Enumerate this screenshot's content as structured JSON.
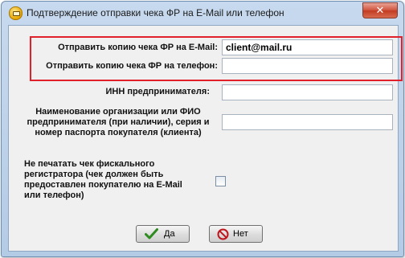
{
  "window": {
    "title": "Подтверждение отправки чека ФР на E-Mail или телефон",
    "close_glyph": "✕"
  },
  "form": {
    "email_label": "Отправить копию чека ФР на  E-Mail:",
    "email_value": "client@mail.ru",
    "phone_label": "Отправить копию чека ФР на телефон:",
    "phone_value": "",
    "inn_label": "ИНН предпринимателя:",
    "inn_value": "",
    "org_label": [
      "Наименование организации или ФИО",
      "предпринимателя (при наличии), серия и",
      "номер паспорта покупателя (клиента)"
    ],
    "org_value": "",
    "noprint_label": [
      "Не печатать чек фискального",
      "регистратора (чек должен быть",
      "предоставлен покупателю на E-Mail",
      "или телефон)"
    ],
    "noprint_checked": false
  },
  "buttons": {
    "yes_label": "Да",
    "no_label": "Нет"
  },
  "colors": {
    "highlight": "#e0202a",
    "yes_icon": "#2e8b1f",
    "no_icon": "#c0161d"
  },
  "icons": {
    "app": "receipt-app-icon",
    "yes": "checkmark-icon",
    "no": "no-entry-icon"
  }
}
